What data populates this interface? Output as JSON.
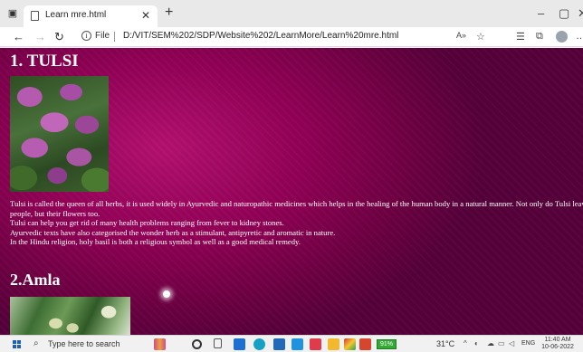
{
  "browser": {
    "tab_title": "Learn mre.html",
    "new_tab_symbol": "+",
    "address_scheme": "File",
    "address_url": "D:/VIT/SEM%202/SDP/Website%202/LearnMore/Learn%20mre.html",
    "window_controls": [
      "–",
      "▢",
      "✕"
    ]
  },
  "page": {
    "heading_tulsi": "1. TULSI",
    "tulsi_paragraph": [
      "Tulsi is called the queen of all herbs, it is used widely in Ayurvedic and naturopathic medicines which helps in the healing of the human body in a natural manner. Not only do Tulsi leaves benefit",
      "people, but their flowers too.",
      "Tulsi can help you get rid of many health problems ranging from fever to kidney stones.",
      "Ayurvedic texts have also categorised the wonder herb as a stimulant, antipyretic and aromatic in nature.",
      "In the Hindu religion, holy basil is both a religious symbol as well as a good medical remedy."
    ],
    "heading_amla": "2.Amla",
    "background_color": "#900055"
  },
  "taskbar": {
    "search_placeholder": "Type here to search",
    "battery": "91%",
    "weather": "31°C",
    "language": "ENG",
    "time": "11:40 AM",
    "date": "10-06-2022"
  }
}
